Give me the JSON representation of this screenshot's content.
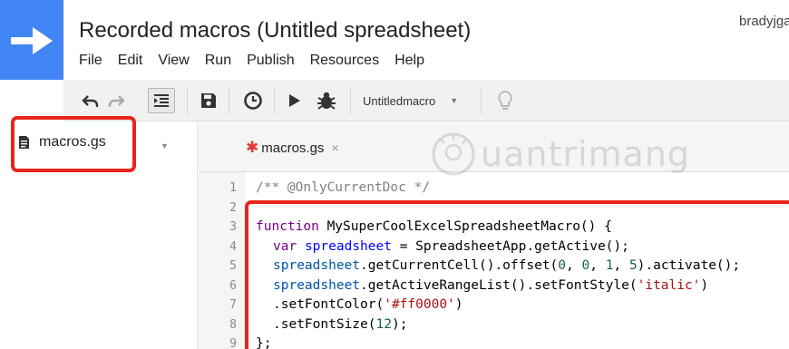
{
  "header": {
    "title": "Recorded macros (Untitled spreadsheet)",
    "user": "bradyjga",
    "logo_icon": "arrow-right-icon",
    "logo_color": "#4285f4"
  },
  "menu": [
    "File",
    "Edit",
    "View",
    "Run",
    "Publish",
    "Resources",
    "Help"
  ],
  "toolbar": {
    "icons": [
      "undo-icon",
      "redo-icon",
      "indent-icon",
      "save-icon",
      "clock-icon",
      "play-icon",
      "bug-icon",
      "lightbulb-icon"
    ],
    "function_select": "Untitledmacro"
  },
  "file_panel": {
    "file_name": "macros.gs"
  },
  "editor": {
    "tab_label": "macros.gs",
    "tab_modified_marker": "✱",
    "tab_close": "×",
    "lines": [
      {
        "num": "1",
        "segments": [
          {
            "t": "/** @OnlyCurrentDoc */",
            "c": "comment"
          }
        ]
      },
      {
        "num": "2",
        "segments": []
      },
      {
        "num": "3",
        "segments": [
          {
            "t": "function",
            "c": "kw"
          },
          {
            "t": " MySuperCoolExcelSpreadsheetMacro() {",
            "c": "plain"
          }
        ]
      },
      {
        "num": "4",
        "indent": true,
        "segments": [
          {
            "t": "var",
            "c": "kw"
          },
          {
            "t": " ",
            "c": "plain"
          },
          {
            "t": "spreadsheet",
            "c": "def"
          },
          {
            "t": " = SpreadsheetApp.getActive();",
            "c": "plain"
          }
        ]
      },
      {
        "num": "5",
        "indent": true,
        "segments": [
          {
            "t": "spreadsheet",
            "c": "var"
          },
          {
            "t": ".getCurrentCell().offset(",
            "c": "plain"
          },
          {
            "t": "0",
            "c": "num"
          },
          {
            "t": ", ",
            "c": "plain"
          },
          {
            "t": "0",
            "c": "num"
          },
          {
            "t": ", ",
            "c": "plain"
          },
          {
            "t": "1",
            "c": "num"
          },
          {
            "t": ", ",
            "c": "plain"
          },
          {
            "t": "5",
            "c": "num"
          },
          {
            "t": ").activate();",
            "c": "plain"
          }
        ]
      },
      {
        "num": "6",
        "indent": true,
        "segments": [
          {
            "t": "spreadsheet",
            "c": "var"
          },
          {
            "t": ".getActiveRangeList().setFontStyle(",
            "c": "plain"
          },
          {
            "t": "'italic'",
            "c": "str"
          },
          {
            "t": ")",
            "c": "plain"
          }
        ]
      },
      {
        "num": "7",
        "indent": true,
        "segments": [
          {
            "t": ".setFontColor(",
            "c": "plain"
          },
          {
            "t": "'#ff0000'",
            "c": "str"
          },
          {
            "t": ")",
            "c": "plain"
          }
        ]
      },
      {
        "num": "8",
        "indent": true,
        "segments": [
          {
            "t": ".setFontSize(",
            "c": "plain"
          },
          {
            "t": "12",
            "c": "num"
          },
          {
            "t": ");",
            "c": "plain"
          }
        ]
      },
      {
        "num": "9",
        "segments": [
          {
            "t": "};",
            "c": "plain"
          }
        ]
      }
    ]
  },
  "highlight_color": "#e8251c",
  "watermark": "uantrimang"
}
